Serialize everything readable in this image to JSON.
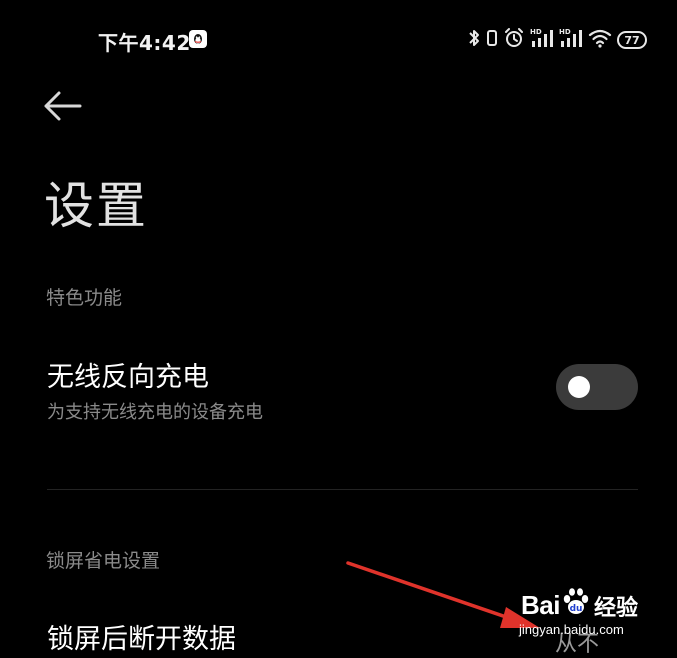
{
  "status_bar": {
    "time": "下午4:42",
    "notification_icon": "qq-penguin-icon",
    "icons": [
      "bluetooth-icon",
      "vibrate-icon",
      "alarm-icon",
      "hd-signal-icon",
      "hd-signal-icon",
      "wifi-icon"
    ],
    "battery_level": "77"
  },
  "header": {
    "back_icon": "arrow-left-icon",
    "title": "设置"
  },
  "sections": [
    {
      "header": "特色功能",
      "items": [
        {
          "title": "无线反向充电",
          "summary": "为支持无线充电的设备充电",
          "toggle_on": false
        }
      ]
    },
    {
      "header": "锁屏省电设置",
      "items": [
        {
          "title": "锁屏后断开数据",
          "summary": "从不"
        }
      ]
    }
  ],
  "overlay": {
    "arrow_color": "#e0332b"
  },
  "watermark": {
    "brand": "Bai",
    "brand_tail": "",
    "product": "经验",
    "url": "jingyan.baidu.com"
  }
}
